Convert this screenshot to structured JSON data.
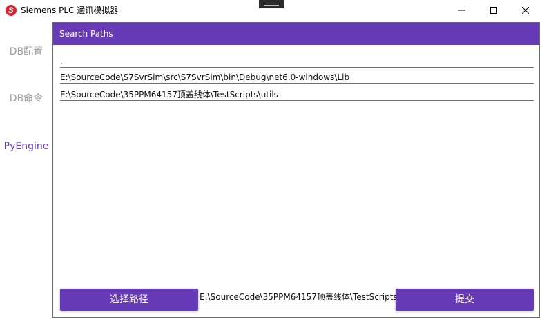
{
  "window": {
    "title": "Siemens PLC 通讯模拟器",
    "logo_icon": "siemens-s-logo-icon",
    "accent_color": "#673ab7",
    "logo_color": "#e01e2b"
  },
  "sidebar": {
    "items": [
      {
        "label": "DB配置",
        "active": false
      },
      {
        "label": "DB命令",
        "active": false
      },
      {
        "label": "PyEngine",
        "active": true
      }
    ]
  },
  "panel": {
    "title": "Search Paths",
    "paths": [
      ".",
      "E:\\SourceCode\\S7SvrSim\\src\\S7SvrSim\\bin\\Debug\\net6.0-windows\\Lib",
      "E:\\SourceCode\\35PPM64157顶盖线体\\TestScripts\\utils"
    ],
    "select_button": "选择路径",
    "selected_path": "E:\\SourceCode\\35PPM64157顶盖线体\\TestScripts\\",
    "submit_button": "提交"
  }
}
